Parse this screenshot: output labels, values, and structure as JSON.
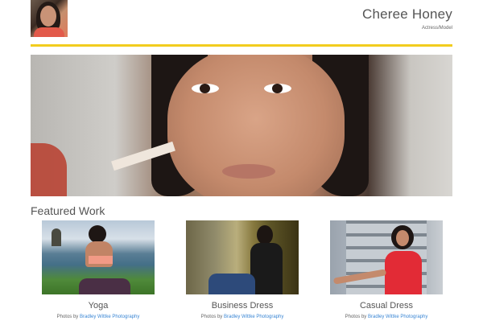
{
  "header": {
    "title": "Cheree Honey",
    "subtitle": "Actress/Model"
  },
  "colors": {
    "accent": "#f2cd1e",
    "link": "#3a86d4"
  },
  "section": {
    "title": "Featured Work"
  },
  "cards": [
    {
      "label": "Yoga",
      "credit_prefix": "Photos by",
      "credit_link": "Bradley Wittke Photography"
    },
    {
      "label": "Business Dress",
      "credit_prefix": "Photos by",
      "credit_link": "Bradley Wittke Photography"
    },
    {
      "label": "Casual Dress",
      "credit_prefix": "Photos by",
      "credit_link": "Bradley Wittke Photography"
    }
  ]
}
